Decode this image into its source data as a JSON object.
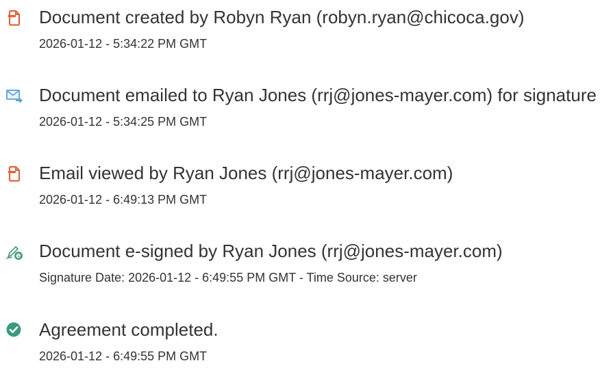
{
  "events": [
    {
      "icon": "document-created-icon",
      "title": "Document created by Robyn Ryan (robyn.ryan@chicoca.gov)",
      "meta": "2026-01-12 - 5:34:22 PM GMT"
    },
    {
      "icon": "email-sent-icon",
      "title": "Document emailed to Ryan Jones (rrj@jones-mayer.com) for signature",
      "meta": "2026-01-12 - 5:34:25 PM GMT"
    },
    {
      "icon": "email-viewed-icon",
      "title": "Email viewed by Ryan Jones (rrj@jones-mayer.com)",
      "meta": "2026-01-12 - 6:49:13 PM GMT"
    },
    {
      "icon": "e-signed-icon",
      "title": "Document e-signed by Ryan Jones (rrj@jones-mayer.com)",
      "meta": "Signature Date: 2026-01-12 - 6:49:55 PM GMT - Time Source: server"
    },
    {
      "icon": "agreement-completed-icon",
      "title": "Agreement completed.",
      "meta": "2026-01-12 - 6:49:55 PM GMT"
    }
  ],
  "colors": {
    "document_icon": "#e0633a",
    "email_icon": "#5a9fd6",
    "sign_icon": "#4e9a8b",
    "completed_icon": "#3a9a80",
    "text": "#333333"
  }
}
